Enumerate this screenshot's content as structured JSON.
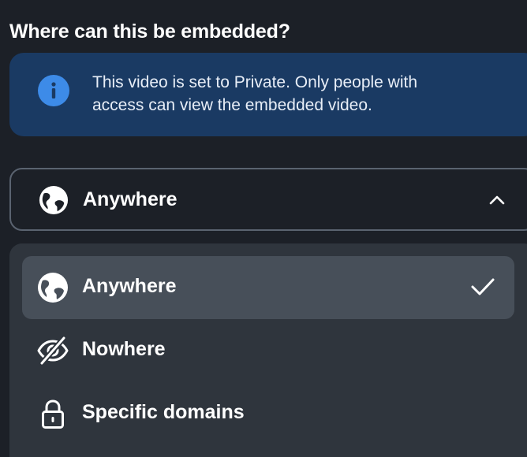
{
  "heading": "Where can this be embedded?",
  "notice": {
    "icon": "info-icon",
    "line1": "This video is set to Private. Only people with",
    "line2": "access can view the embedded video."
  },
  "select": {
    "value": "Anywhere",
    "icon": "globe-icon",
    "expanded": true
  },
  "menu": {
    "options": [
      {
        "label": "Anywhere",
        "icon": "globe-icon",
        "selected": true
      },
      {
        "label": "Nowhere",
        "icon": "eye-slash-icon",
        "selected": false
      },
      {
        "label": "Specific domains",
        "icon": "lock-icon",
        "selected": false
      }
    ]
  },
  "colors": {
    "background": "#1c2027",
    "notice_bg": "#1a3a63",
    "info_accent": "#3d8be8",
    "menu_bg": "#2f353d",
    "selected_bg": "#474f59"
  }
}
